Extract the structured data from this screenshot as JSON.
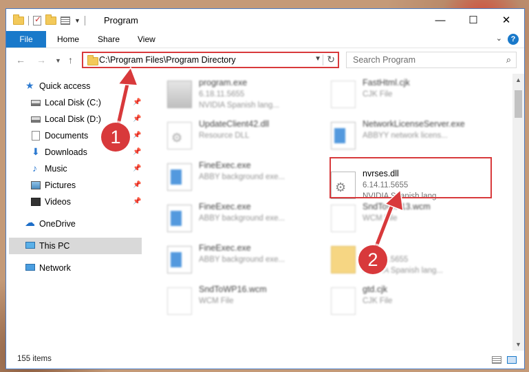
{
  "window": {
    "title": "Program",
    "controls": {
      "minimize": "—",
      "maximize": "☐",
      "close": "✕"
    }
  },
  "ribbon": {
    "tabs": [
      "File",
      "Home",
      "Share",
      "View"
    ],
    "help": "?"
  },
  "navbar": {
    "address": "C:\\Program Files\\Program Directory",
    "search_placeholder": "Search Program"
  },
  "sidebar": {
    "items": [
      {
        "label": "Quick access",
        "icon": "star-icon"
      },
      {
        "label": "Local Disk (C:)",
        "icon": "disk-icon",
        "pinned": true
      },
      {
        "label": "Local Disk (D:)",
        "icon": "disk-icon",
        "pinned": true
      },
      {
        "label": "Documents",
        "icon": "documents-icon",
        "pinned": true
      },
      {
        "label": "Downloads",
        "icon": "download-icon",
        "pinned": true
      },
      {
        "label": "Music",
        "icon": "music-icon",
        "pinned": true
      },
      {
        "label": "Pictures",
        "icon": "pictures-icon",
        "pinned": true
      },
      {
        "label": "Videos",
        "icon": "videos-icon",
        "pinned": true
      },
      {
        "label": "OneDrive",
        "icon": "cloud-icon"
      },
      {
        "label": "This PC",
        "icon": "computer-icon",
        "selected": true
      },
      {
        "label": "Network",
        "icon": "network-icon"
      }
    ]
  },
  "files": [
    {
      "name": "program.exe",
      "line2": "6.18.11.5655",
      "line3": "NVIDIA Spanish lang...",
      "icon": "installer-icon"
    },
    {
      "name": "FastHtml.cjk",
      "line2": "CJK File",
      "line3": "",
      "icon": "file-icon"
    },
    {
      "name": "UpdateClient42.dll",
      "line2": "Resource DLL",
      "line3": "",
      "icon": "dll-icon"
    },
    {
      "name": "NetworkLicenseServer.exe",
      "line2": "ABBYY network licens...",
      "line3": "",
      "icon": "application-icon"
    },
    {
      "name": "FineExec.exe",
      "line2": "ABBY background exe...",
      "line3": "",
      "icon": "application-icon"
    },
    {
      "name": "nvrses.dll",
      "line2": "6.14.11.5655",
      "line3": "NVIDIA Spanish lang...",
      "icon": "dll-icon",
      "highlighted": true
    },
    {
      "name": "FineExec.exe",
      "line2": "ABBY background exe...",
      "line3": "",
      "icon": "application-icon"
    },
    {
      "name": "SndToWP13.wcm",
      "line2": "WCM File",
      "line3": "",
      "icon": "file-icon"
    },
    {
      "name": "FineExec.exe",
      "line2": "ABBY background exe...",
      "line3": "",
      "icon": "application-icon"
    },
    {
      "name": "",
      "line2": "6.14.11.5655",
      "line3": "NVIDIA Spanish lang...",
      "icon": "folder-icon"
    },
    {
      "name": "SndToWP16.wcm",
      "line2": "WCM File",
      "line3": "",
      "icon": "file-icon"
    },
    {
      "name": "gtd.cjk",
      "line2": "CJK File",
      "line3": "",
      "icon": "file-icon"
    }
  ],
  "status": {
    "item_count": "155 items"
  },
  "callouts": [
    {
      "number": "1"
    },
    {
      "number": "2"
    }
  ],
  "colors": {
    "accent": "#1979ca",
    "highlight": "#d8393b",
    "selected_nav": "#d9d9d9"
  }
}
